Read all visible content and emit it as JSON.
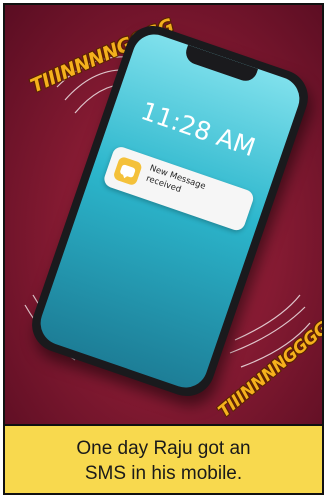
{
  "sound_effects": {
    "top": "TIIINNNNGGGG",
    "bottom": "TIIINNNNGGGG"
  },
  "phone": {
    "time": "11:28 AM",
    "notification": {
      "icon": "message-bubble-icon",
      "line1": "New Message",
      "line2": "received"
    }
  },
  "caption": {
    "line1": "One day Raju got an",
    "line2": "SMS in his mobile."
  },
  "colors": {
    "background": "#8a1c34",
    "sfx": "#f5b11d",
    "caption_box": "#f8d94e",
    "screen": "#2cb6cc"
  }
}
